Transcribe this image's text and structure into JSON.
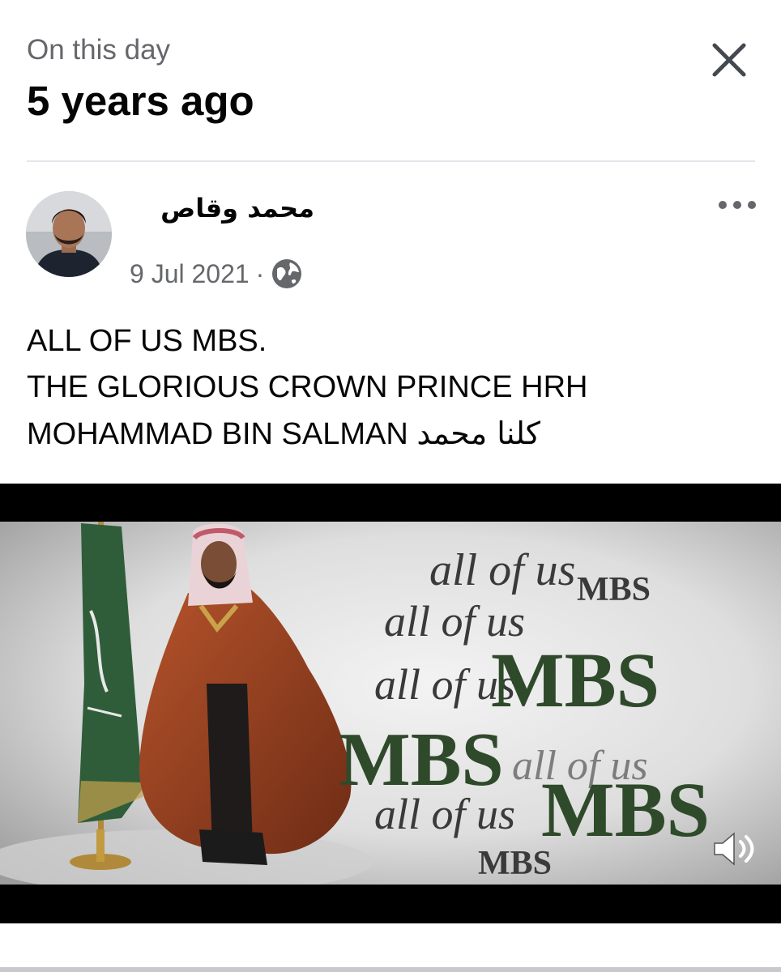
{
  "memory": {
    "subtitle": "On this day",
    "title": "5 years ago"
  },
  "post": {
    "author": "محمد وقاص",
    "date": "9 Jul 2021",
    "separator": "·",
    "text_line1": "ALL OF US MBS.",
    "text_line2": "THE GLORIOUS CROWN PRINCE HRH",
    "text_line3": "MOHAMMAD BIN SALMAN",
    "text_line3_arabic": "كلنا محمد"
  },
  "video": {
    "overlay_words": {
      "w1": "all of us",
      "w2": "MBS",
      "w3": "all of us",
      "w4": "all of us",
      "w5": "MBS",
      "w6": "MBS",
      "w7": "all of us",
      "w8": "all of us",
      "w9": "MBS",
      "w10": "MBS"
    }
  },
  "icons": {
    "close": "close-icon",
    "more": "more-options-icon",
    "globe": "globe-icon",
    "volume": "volume-icon"
  },
  "colors": {
    "text_primary": "#050505",
    "text_secondary": "#65676b",
    "divider": "#e4e6eb",
    "flag_green": "#2f5d3a",
    "robe_brown": "#8a3a1e"
  }
}
